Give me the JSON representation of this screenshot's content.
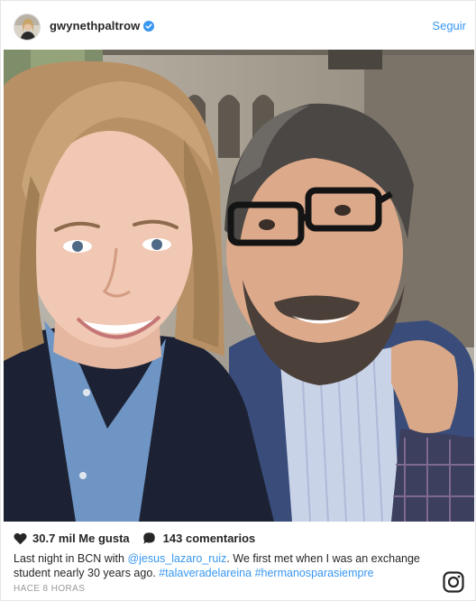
{
  "header": {
    "username": "gwynethpaltrow",
    "follow_label": "Seguir"
  },
  "stats": {
    "likes_label": "30.7 mil Me gusta",
    "comments_label": "143 comentarios"
  },
  "caption": {
    "text_1": "Last night in BCN with ",
    "mention": "@jesus_lazaro_ruiz",
    "text_2": ". We first met when I was an exchange student nearly 30 years ago. ",
    "hashtag_1": "#talaveradelareina",
    "hashtag_2": "#hermanosparasiempre"
  },
  "timestamp": "HACE 8 HORAS",
  "colors": {
    "link": "#3897f0",
    "text": "#262626",
    "muted": "#999999"
  },
  "icons": {
    "verified": "verified-badge-icon",
    "heart": "heart-icon",
    "comment": "comment-bubble-icon",
    "instagram": "instagram-logo-icon"
  }
}
